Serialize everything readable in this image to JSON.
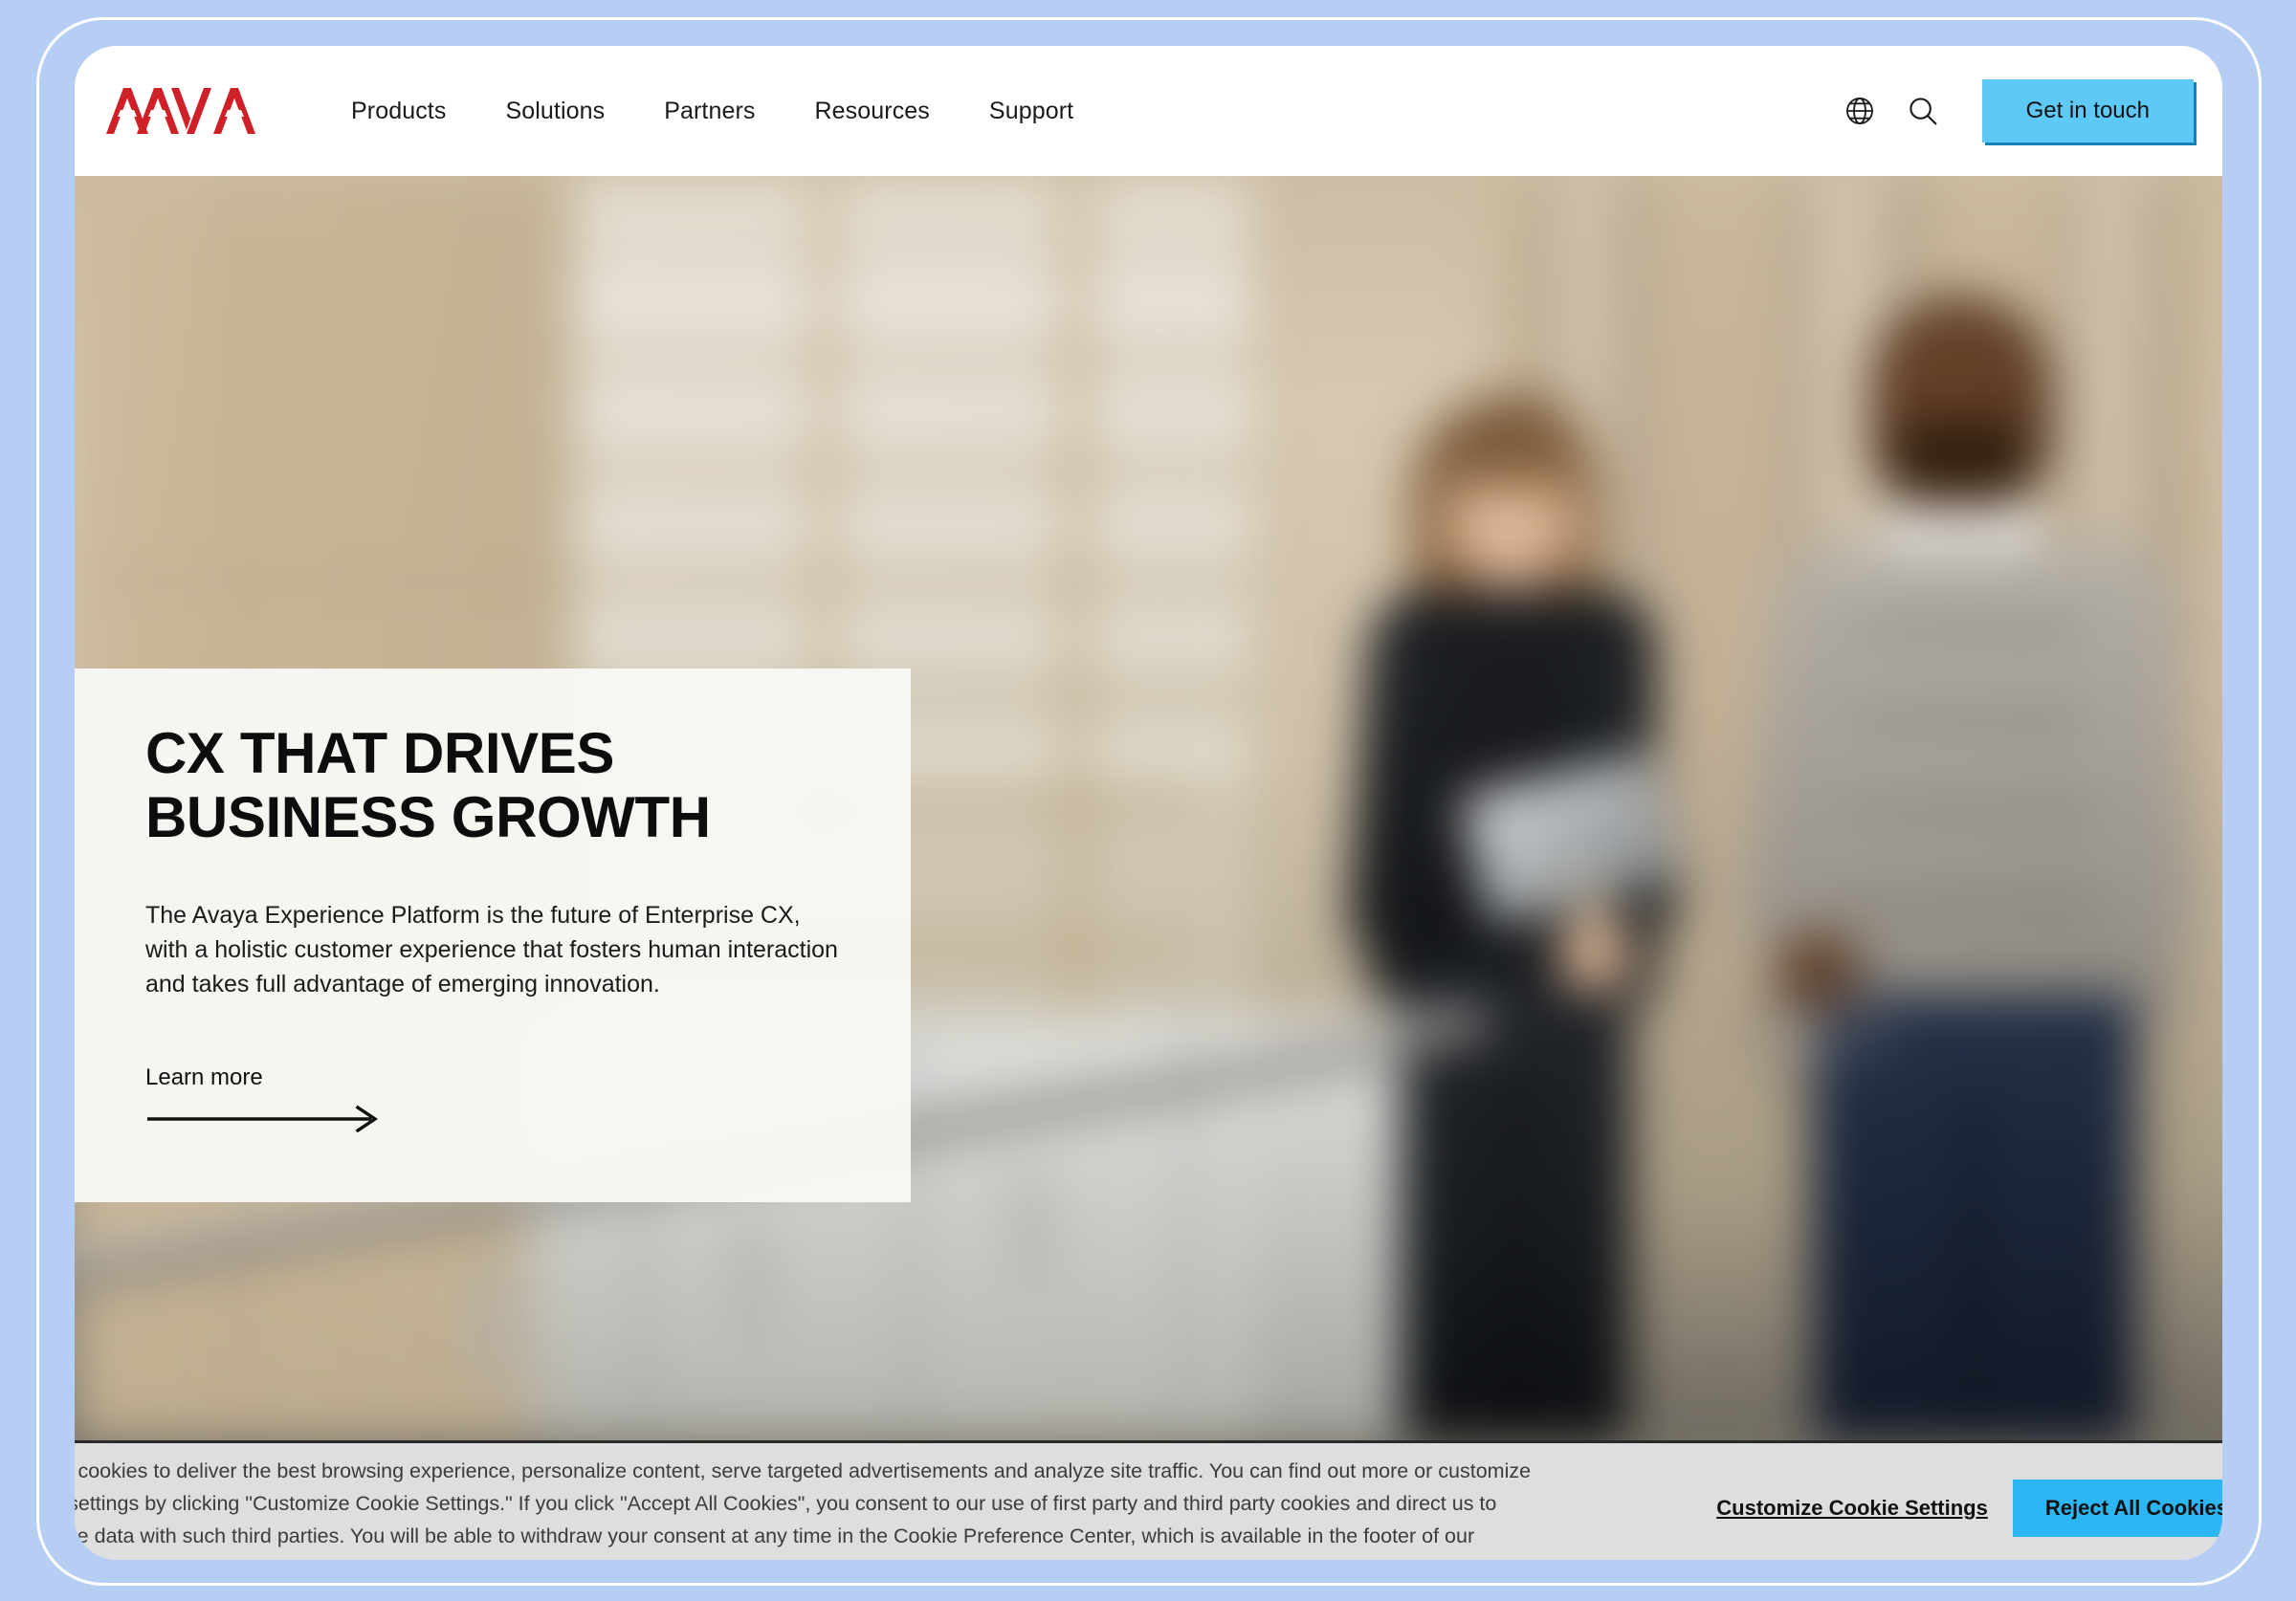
{
  "nav": {
    "logo_alt": "AVAYA",
    "links": [
      {
        "label": "Products"
      },
      {
        "label": "Solutions"
      },
      {
        "label": "Partners"
      },
      {
        "label": "Resources"
      },
      {
        "label": "Support"
      }
    ],
    "globe_icon": "globe-icon",
    "search_icon": "search-icon",
    "cta_label": "Get in touch",
    "cta_color": "#5ec8f7"
  },
  "hero": {
    "title": "CX THAT DRIVES\nBUSINESS GROWTH",
    "description": "The Avaya Experience Platform is the future of Enterprise CX, with a holistic customer experience that fosters human interaction and takes full advantage of emerging innovation.",
    "link_label": "Learn more",
    "link_icon": "arrow-right-icon"
  },
  "cookie_banner": {
    "text": "We use cookies to deliver the best browsing experience, personalize content, serve targeted advertisements and analyze site traffic. You can find out more or customize cookie settings by clicking \"Customize Cookie Settings.\" If you click \"Accept All Cookies\", you consent to our use of first party and third party cookies and direct us to share the data with such third parties. You will be able to withdraw your consent at any time in the Cookie Preference Center, which is available in the footer of our website. If you click \"Reject All Cookies\", you do not allow us to set cookies (except strictly necessary cookies) on your browser.",
    "customize_label": "Customize Cookie Settings",
    "reject_label": "Reject All Cookies",
    "reject_color": "#2cb6f4"
  },
  "theme": {
    "page_background": "#b6cef3",
    "frame_border": "#ffffff",
    "brand_red": "#cf2027",
    "panel_background": "#f9f8f5"
  }
}
